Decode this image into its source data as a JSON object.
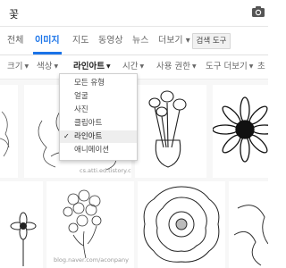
{
  "search": {
    "query": "꽃"
  },
  "tabs": [
    {
      "label": "전체"
    },
    {
      "label": "이미지"
    },
    {
      "label": "지도"
    },
    {
      "label": "동영상"
    },
    {
      "label": "뉴스"
    },
    {
      "label": "더보기 ▾"
    }
  ],
  "tools_button": {
    "label": "검색 도구"
  },
  "filters": [
    {
      "label": "크기"
    },
    {
      "label": "색상"
    },
    {
      "label": "라인아트"
    },
    {
      "label": "시간"
    },
    {
      "label": "사용 권한"
    },
    {
      "label": "도구 더보기"
    },
    {
      "label": "초"
    }
  ],
  "type_dropdown": {
    "items": [
      {
        "label": "모든 유형"
      },
      {
        "label": "얼굴"
      },
      {
        "label": "사진"
      },
      {
        "label": "클립아트"
      },
      {
        "label": "라인아트",
        "check": "✓"
      },
      {
        "label": "애니메이션"
      }
    ]
  },
  "results": {
    "watermark": "blog.naver.com/aconpany"
  },
  "colors": {
    "accent": "#1a73e8",
    "tab_text": "#666666",
    "toolbar_bg": "#f1f1f1"
  }
}
